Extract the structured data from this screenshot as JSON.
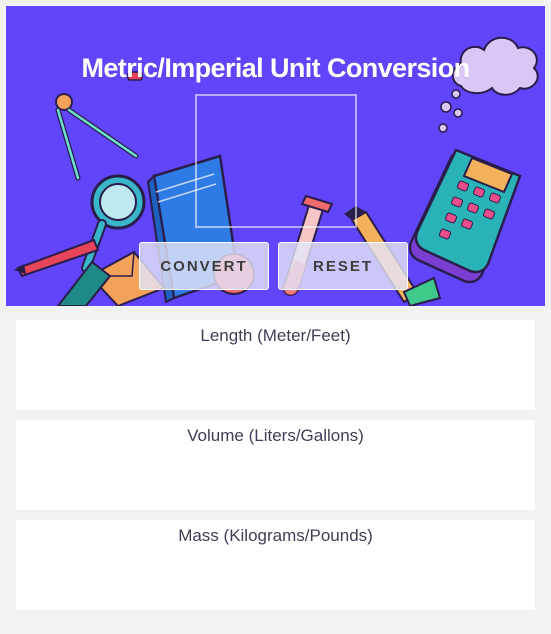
{
  "header": {
    "title": "Metric/Imperial Unit Conversion",
    "input_value": ""
  },
  "buttons": {
    "convert_label": "CONVERT",
    "reset_label": "RESET"
  },
  "results": [
    {
      "label": "Length (Meter/Feet)",
      "value": ""
    },
    {
      "label": "Volume (Liters/Gallons)",
      "value": ""
    },
    {
      "label": "Mass (Kilograms/Pounds)",
      "value": ""
    }
  ],
  "colors": {
    "hero_background": "#6145fb",
    "page_background": "#f1f2f2",
    "card_background": "#ffffff",
    "card_text": "#3e3f57",
    "button_background": "#e4e4f8"
  },
  "icons": [
    "compass-icon",
    "magnifier-icon",
    "book-icon",
    "test-tube-icon",
    "pencil-icon",
    "calculator-icon",
    "cloud-icon",
    "envelope-icon",
    "pen-icon",
    "apple-icon",
    "eraser-icon"
  ]
}
